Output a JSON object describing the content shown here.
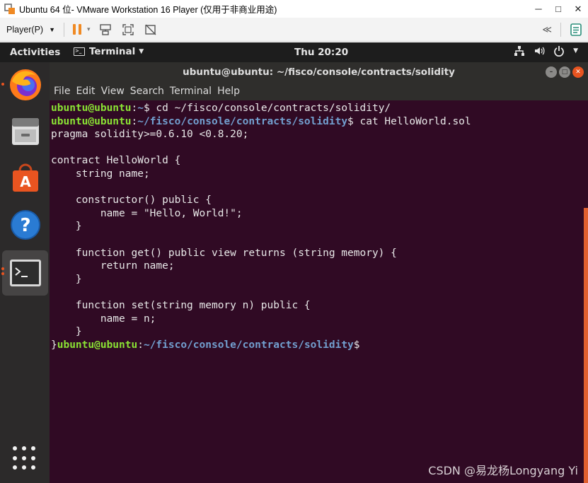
{
  "vmware": {
    "title": "Ubuntu 64 位- VMware Workstation 16 Player (仅用于非商业用途)",
    "controls": [
      "－",
      "□",
      "✕"
    ],
    "player_menu": "Player(P)",
    "pause_caret": "▾",
    "collapse": "≪",
    "accent": "#f08a24"
  },
  "topbar": {
    "activities": "Activities",
    "app_name": "Terminal",
    "clock": "Thu 20:20"
  },
  "dock": {
    "items": [
      "firefox",
      "files",
      "ubuntu-software",
      "help",
      "terminal"
    ]
  },
  "terminal": {
    "title": "ubuntu@ubuntu: ~/fisco/console/contracts/solidity",
    "menu": [
      "File",
      "Edit",
      "View",
      "Search",
      "Terminal",
      "Help"
    ],
    "user_host": "ubuntu@ubuntu",
    "lines": [
      {
        "kind": "prompt",
        "path": "~",
        "cmd": " cd ~/fisco/console/contracts/solidity/"
      },
      {
        "kind": "prompt",
        "path": "~/fisco/console/contracts/solidity",
        "cmd": " cat HelloWorld.sol"
      },
      {
        "kind": "text",
        "text": "pragma solidity>=0.6.10 <0.8.20;"
      },
      {
        "kind": "text",
        "text": ""
      },
      {
        "kind": "text",
        "text": "contract HelloWorld {"
      },
      {
        "kind": "text",
        "text": "    string name;"
      },
      {
        "kind": "text",
        "text": ""
      },
      {
        "kind": "text",
        "text": "    constructor() public {"
      },
      {
        "kind": "text",
        "text": "        name = \"Hello, World!\";"
      },
      {
        "kind": "text",
        "text": "    }"
      },
      {
        "kind": "text",
        "text": ""
      },
      {
        "kind": "text",
        "text": "    function get() public view returns (string memory) {"
      },
      {
        "kind": "text",
        "text": "        return name;"
      },
      {
        "kind": "text",
        "text": "    }"
      },
      {
        "kind": "text",
        "text": ""
      },
      {
        "kind": "text",
        "text": "    function set(string memory n) public {"
      },
      {
        "kind": "text",
        "text": "        name = n;"
      },
      {
        "kind": "text",
        "text": "    }"
      },
      {
        "kind": "prompt",
        "prefix": "}",
        "path": "~/fisco/console/contracts/solidity",
        "cmd": ""
      }
    ],
    "colors": {
      "background": "#300a24",
      "user": "#8ae234",
      "path": "#729fcf",
      "text": "#e8e8e8"
    }
  },
  "watermark": "CSDN @易龙杨Longyang Yi"
}
